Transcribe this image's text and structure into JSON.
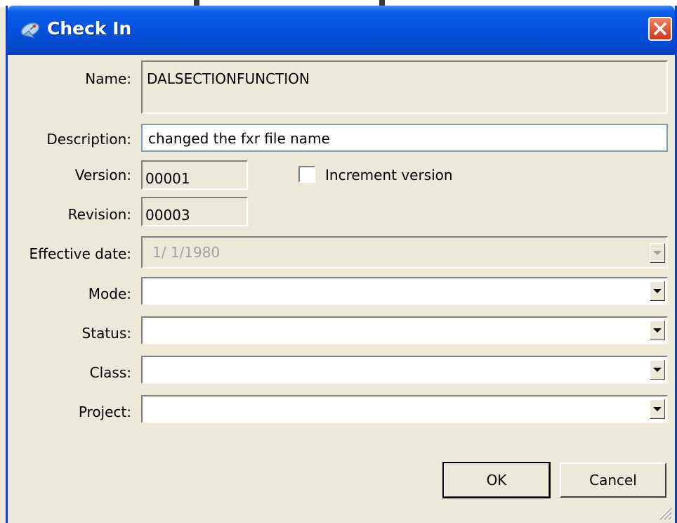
{
  "dialog": {
    "title": "Check In",
    "close_label": "✕"
  },
  "form": {
    "name_label": "Name:",
    "name_value": "DALSECTIONFUNCTION",
    "description_label": "Description:",
    "description_value": "changed the fxr file name",
    "version_label": "Version:",
    "version_value": "00001",
    "increment_label": "Increment version",
    "increment_checked": false,
    "revision_label": "Revision:",
    "revision_value": "00003",
    "effective_date_label": "Effective date:",
    "effective_date_value": "1/  1/1980",
    "mode_label": "Mode:",
    "mode_value": "",
    "status_label": "Status:",
    "status_value": "",
    "class_label": "Class:",
    "class_value": "",
    "project_label": "Project:",
    "project_value": ""
  },
  "buttons": {
    "ok": "OK",
    "cancel": "Cancel"
  },
  "colors": {
    "titlebar": "#0550dd",
    "dialog_bg": "#ece9d8",
    "close_button": "#d03818"
  },
  "icons": {
    "title": "satellite-dish-icon",
    "close": "close-icon",
    "dropdown": "chevron-down-icon",
    "resize": "resize-grip-icon"
  }
}
